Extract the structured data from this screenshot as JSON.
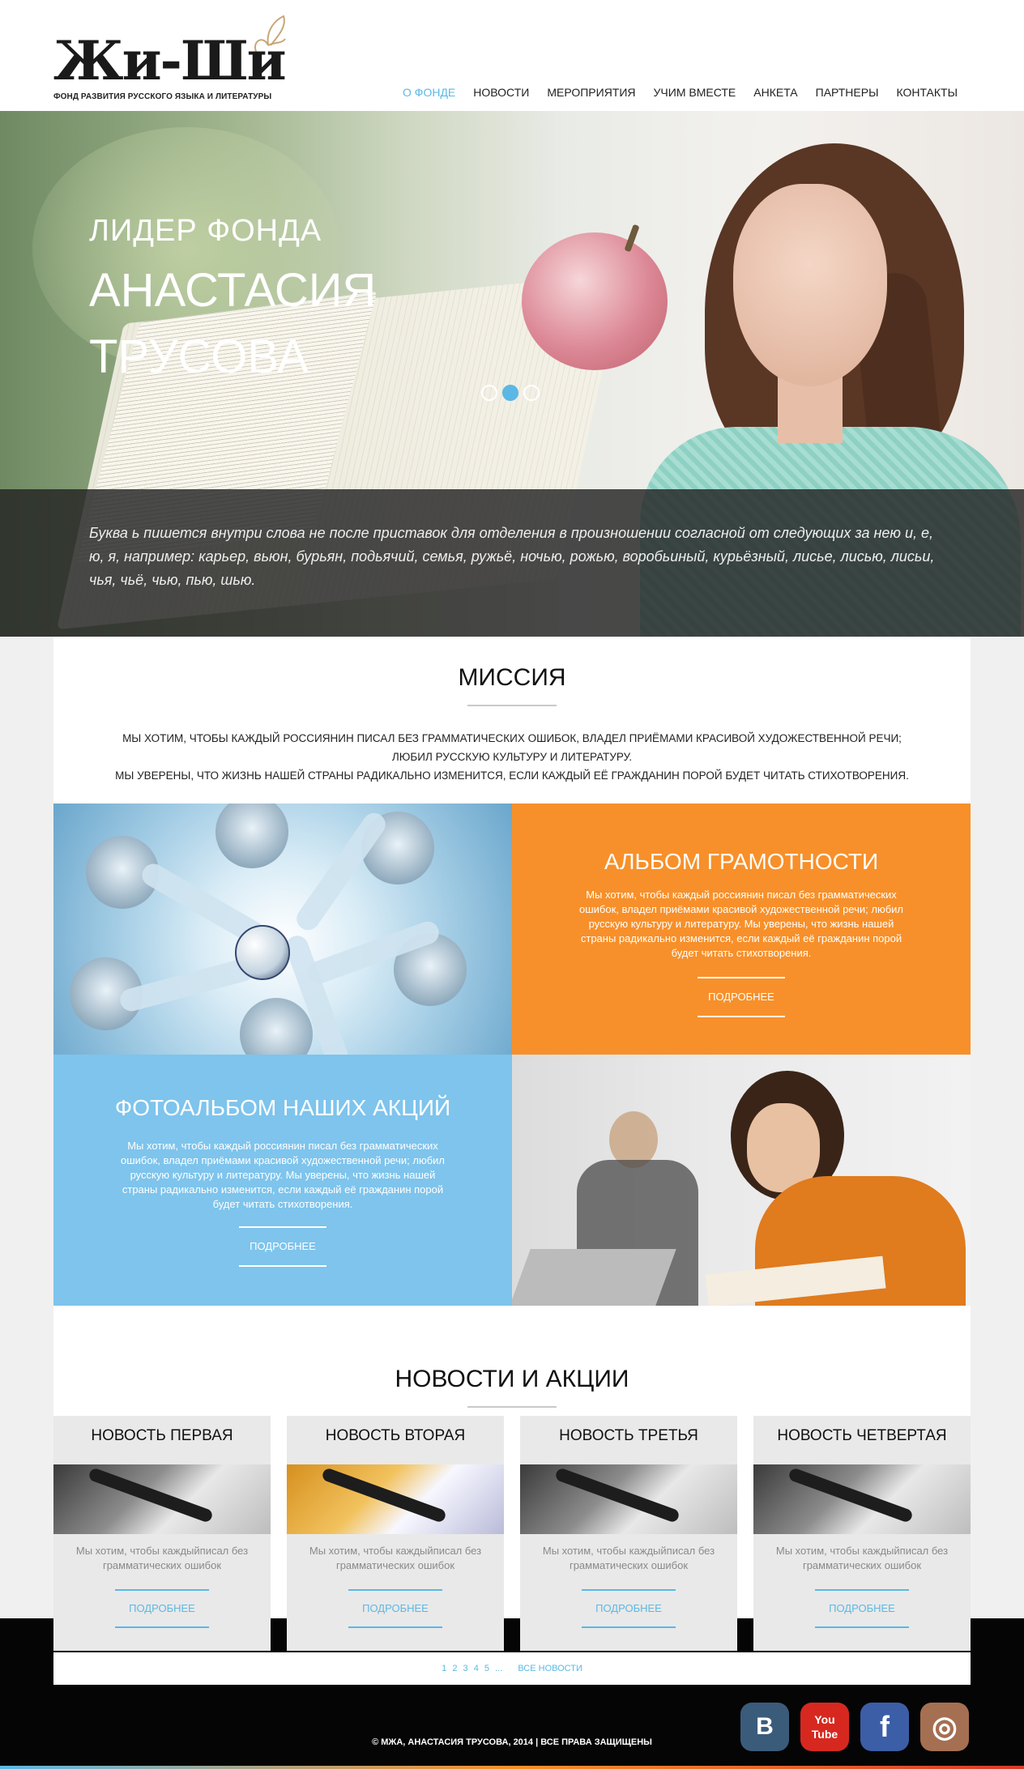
{
  "header": {
    "logo_text": "Жи-Ши",
    "logo_subtitle": "ФОНД РАЗВИТИЯ РУССКОГО ЯЗЫКА И ЛИТЕРАТУРЫ",
    "nav": [
      {
        "label": "О ФОНДЕ",
        "active": true
      },
      {
        "label": "НОВОСТИ",
        "active": false
      },
      {
        "label": "МЕРОПРИЯТИЯ",
        "active": false
      },
      {
        "label": "УЧИМ ВМЕСТЕ",
        "active": false
      },
      {
        "label": "АНКЕТА",
        "active": false
      },
      {
        "label": "ПАРТНЕРЫ",
        "active": false
      },
      {
        "label": "КОНТАКТЫ",
        "active": false
      }
    ]
  },
  "hero": {
    "subtitle": "ЛИДЕР ФОНДА",
    "title": "АНАСТАСИЯ ТРУСОВА",
    "slides": 3,
    "active_slide": 2,
    "quote": "Буква ь пишется внутри слова не после приставок для отделения в произношении согласной от следующих за нею и, е, ю, я, например: карьер, вьюн, бурьян, подьячий, семья, ружьё, ночью, рожью, воробьиный, курьёзный, лисье, лисью, лисьи, чья, чьё, чью, пью, шью."
  },
  "mission": {
    "title": "МИССИЯ",
    "lines": [
      "МЫ ХОТИМ, ЧТОБЫ КАЖДЫЙ РОССИЯНИН ПИСАЛ БЕЗ ГРАММАТИЧЕСКИХ ОШИБОК, ВЛАДЕЛ ПРИЁМАМИ КРАСИВОЙ ХУДОЖЕСТВЕННОЙ РЕЧИ;",
      "ЛЮБИЛ РУССКУЮ КУЛЬТУРУ И ЛИТЕРАТУРУ.",
      "МЫ УВЕРЕНЫ, ЧТО ЖИЗНЬ НАШЕЙ СТРАНЫ РАДИКАЛЬНО ИЗМЕНИТСЯ, ЕСЛИ КАЖДЫЙ ЕЁ ГРАЖДАНИН ПОРОЙ БУДЕТ ЧИТАТЬ СТИХОТВОРЕНИЯ."
    ]
  },
  "tiles": {
    "album": {
      "title": "АЛЬБОМ ГРАМОТНОСТИ",
      "text": "Мы хотим, чтобы каждый россиянин писал без грамматических ошибок, владел приёмами красивой художественной речи; любил русскую культуру и литературу. Мы уверены, что жизнь нашей страны радикально изменится, если каждый её гражданин порой будет читать стихотворения.",
      "button": "ПОДРОБНЕЕ",
      "color": "#f7902a"
    },
    "photoalbum": {
      "title": "ФОТОАЛЬБОМ НАШИХ АКЦИЙ",
      "text": "Мы хотим, чтобы каждый россиянин писал без грамматических ошибок, владел приёмами красивой художественной речи; любил русскую культуру и литературу. Мы уверены, что жизнь нашей страны радикально изменится, если каждый её гражданин порой будет читать стихотворения.",
      "button": "ПОДРОБНЕЕ",
      "color": "#7ec4ec"
    }
  },
  "news": {
    "title": "НОВОСТИ И АКЦИИ",
    "items": [
      {
        "title": "НОВОСТЬ ПЕРВАЯ",
        "text": "Мы хотим, чтобы каждыйписал без грамматических ошибок",
        "button": "ПОДРОБНЕЕ"
      },
      {
        "title": "НОВОСТЬ ВТОРАЯ",
        "text": "Мы хотим, чтобы каждыйписал без грамматических ошибок",
        "button": "ПОДРОБНЕЕ"
      },
      {
        "title": "НОВОСТЬ ТРЕТЬЯ",
        "text": "Мы хотим, чтобы каждыйписал без грамматических ошибок",
        "button": "ПОДРОБНЕЕ"
      },
      {
        "title": "НОВОСТЬ ЧЕТВЕРТАЯ",
        "text": "Мы хотим, чтобы каждыйписал без грамматических ошибок",
        "button": "ПОДРОБНЕЕ"
      }
    ],
    "pages": [
      "1",
      "2",
      "3",
      "4",
      "5",
      "..."
    ],
    "all_news": "ВСЕ НОВОСТИ"
  },
  "footer": {
    "copyright": "© МЖА, АНАСТАСИЯ ТРУСОВА, 2014 | ВСЕ ПРАВА ЗАЩИЩЕНЫ",
    "social": [
      {
        "name": "blogger-icon",
        "glyph": "B",
        "color": "#3b5b7b"
      },
      {
        "name": "youtube-icon",
        "glyph": "You Tube",
        "color": "#d7281f"
      },
      {
        "name": "facebook-icon",
        "glyph": "f",
        "color": "#3b5ea7"
      },
      {
        "name": "instagram-icon",
        "glyph": "◎",
        "color": "#a56f52"
      }
    ]
  },
  "colors": {
    "accent": "#5bb8e4",
    "orange": "#f7902a",
    "blue_tile": "#7ec4ec"
  }
}
